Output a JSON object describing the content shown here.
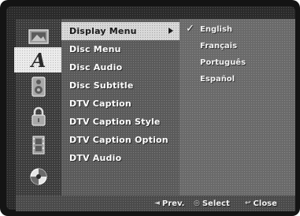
{
  "categories": [
    {
      "name": "picture-icon",
      "active": false
    },
    {
      "name": "language-icon",
      "glyph": "A",
      "active": true
    },
    {
      "name": "audio-speaker-icon",
      "active": false
    },
    {
      "name": "lock-icon",
      "active": false
    },
    {
      "name": "film-icon",
      "active": false
    },
    {
      "name": "disc-icon",
      "active": false
    }
  ],
  "menu": {
    "items": [
      {
        "label": "Display Menu"
      },
      {
        "label": "Disc Menu"
      },
      {
        "label": "Disc Audio"
      },
      {
        "label": "Disc Subtitle"
      },
      {
        "label": "DTV Caption"
      },
      {
        "label": "DTV Caption Style"
      },
      {
        "label": "DTV Caption Option"
      },
      {
        "label": "DTV Audio"
      }
    ],
    "selected_index": 0
  },
  "options": {
    "items": [
      {
        "label": "English",
        "checked": true
      },
      {
        "label": "Français",
        "checked": false
      },
      {
        "label": "Português",
        "checked": false
      },
      {
        "label": "Español",
        "checked": false
      }
    ]
  },
  "footer": {
    "prev_label": "Prev.",
    "prev_icon": "arrow-left-icon",
    "select_label": "Select",
    "select_icon": "enter-icon",
    "close_label": "Close",
    "close_icon": "return-icon"
  },
  "colors": {
    "selected_bg": "#d9d9d9",
    "menu_bg": "#5a5a5a",
    "option_bg": "#6a6a6a"
  }
}
